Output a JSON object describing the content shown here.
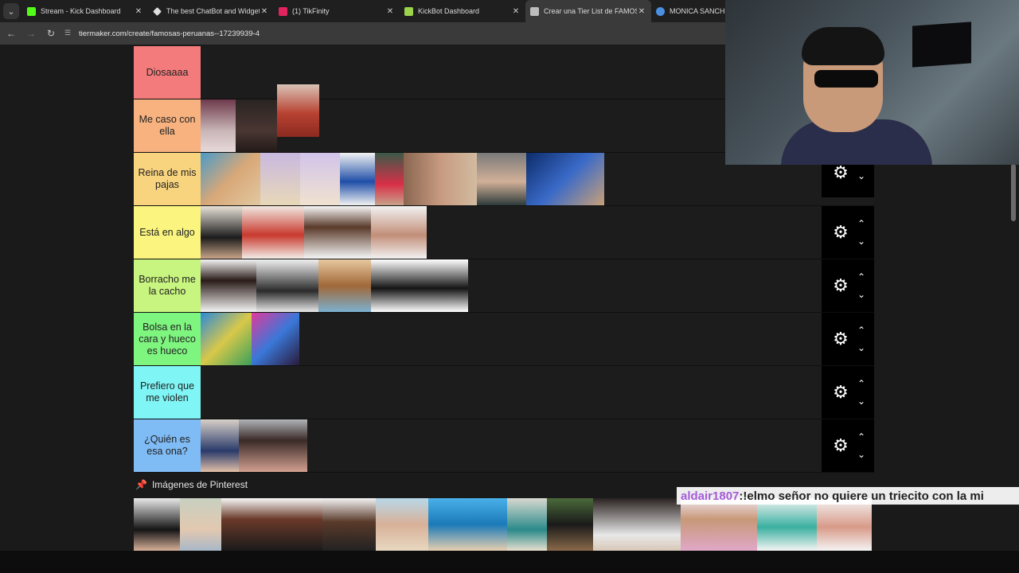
{
  "tabs": [
    {
      "label": "Stream - Kick Dashboard",
      "icon": "kick-icon",
      "color": "#53fc18",
      "active": false
    },
    {
      "label": "The best ChatBot and Widgets",
      "icon": "diamond-icon",
      "color": "#e0e0e0",
      "active": false
    },
    {
      "label": "(1) TikFinity",
      "icon": "tikfinity-icon",
      "color": "#e0245e",
      "active": false
    },
    {
      "label": "KickBot Dashboard",
      "icon": "kickbot-icon",
      "color": "#9bd34a",
      "active": false
    },
    {
      "label": "Crear una Tier List de FAMOSAS",
      "icon": "tiermaker-icon",
      "color": "#bdbdbd",
      "active": true
    },
    {
      "label": "MONICA SANCHEZ -",
      "icon": "chrome-icon",
      "color": "#4a90e2",
      "active": false
    }
  ],
  "address": {
    "url": "tiermaker.com/create/famosas-peruanas--17239939-4"
  },
  "icons": {
    "tab_menu": "chevron-down-icon",
    "back": "←",
    "forward": "→",
    "reload": "↻",
    "site": "☰",
    "gear": "⚙",
    "up": "⌃",
    "down": "⌄",
    "pin": "📌"
  },
  "tiers": [
    {
      "label": "Diosaaaa",
      "color": "#f47b7b"
    },
    {
      "label": "Me caso con ella",
      "color": "#f7b27f"
    },
    {
      "label": "Reina de mis pajas",
      "color": "#f9d47f"
    },
    {
      "label": "Está en algo",
      "color": "#fbf57f"
    },
    {
      "label": "Borracho me la cacho",
      "color": "#c8f57f"
    },
    {
      "label": "Bolsa en la cara y hueco es hueco",
      "color": "#7ef57f"
    },
    {
      "label": "Prefiero que me violen",
      "color": "#7ff5f5"
    },
    {
      "label": "¿Quién es esa ona?",
      "color": "#7fbbf5"
    }
  ],
  "section": {
    "title": "Imágenes de Pinterest"
  },
  "chat": {
    "user": "aldair1807",
    "separator": " : ",
    "message": "!elmo señor no quiere un triecito con la mi"
  }
}
